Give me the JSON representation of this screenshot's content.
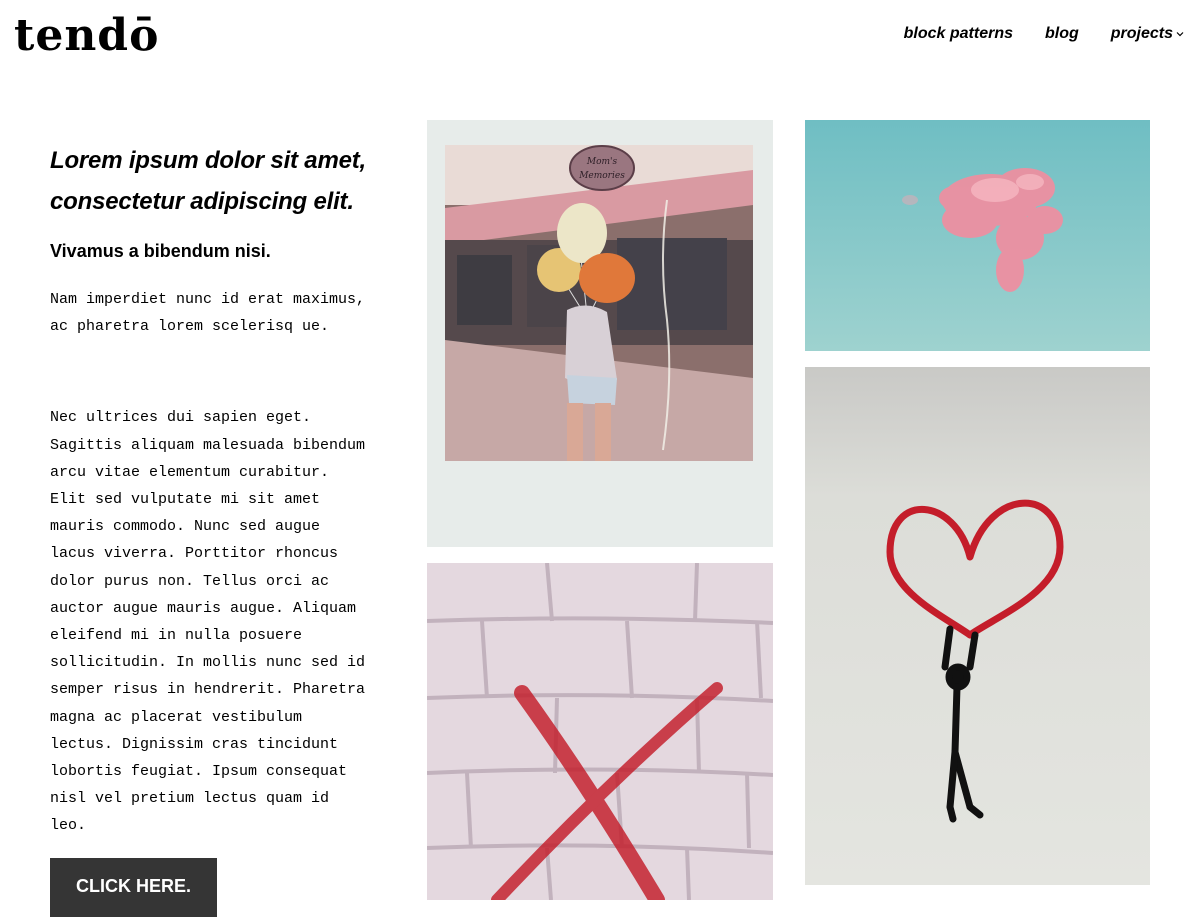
{
  "header": {
    "logo": "tendō",
    "nav": [
      {
        "label": "block patterns"
      },
      {
        "label": "blog"
      },
      {
        "label": "projects",
        "has_dropdown": true,
        "icon": "chevron-down-icon"
      }
    ]
  },
  "intro": {
    "heading_line1": "Lorem ipsum dolor sit amet,",
    "heading_line2": "consectetur adipiscing elit.",
    "subheading": "Vivamus a bibendum nisi.",
    "paragraph1_lines": [
      "Nam imperdiet nunc id erat maximus,",
      "ac pharetra lorem scelerisq ue."
    ],
    "paragraph2_lines": [
      "Nec ultrices dui sapien eget.",
      "Sagittis aliquam malesuada bibendum",
      "arcu vitae elementum curabitur.",
      "Elit sed vulputate mi sit amet",
      "mauris commodo. Nunc sed augue",
      "lacus viverra. Porttitor rhoncus",
      "dolor purus non. Tellus orci ac",
      "auctor augue mauris augue. Aliquam",
      "eleifend mi in nulla posuere",
      "sollicitudin. In mollis nunc sed id",
      "semper risus in hendrerit. Pharetra",
      "magna ac placerat vestibulum",
      "lectus. Dignissim cras tincidunt",
      "lobortis feugiat. Ipsum consequat",
      "nisl vel pretium lectus quam id",
      "leo."
    ],
    "button_label": "CLICK HERE."
  },
  "gallery": {
    "polaroid": {
      "sign_line1": "Mom's",
      "sign_line2": "Memories"
    }
  },
  "colors": {
    "button_bg": "#353535",
    "sky": "#6fbec3",
    "cloud": "#f08ea0",
    "graffiti_red": "#c41d2a"
  }
}
